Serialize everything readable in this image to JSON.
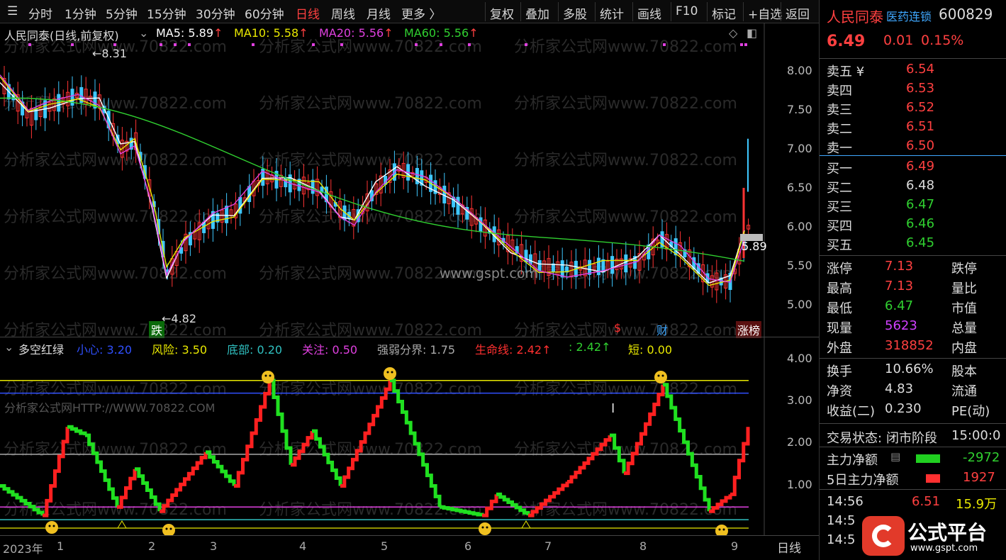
{
  "toolbar": {
    "periods": [
      "分时",
      "1分钟",
      "5分钟",
      "15分钟",
      "30分钟",
      "60分钟",
      "日线",
      "周线",
      "月线",
      "更多 〉"
    ],
    "active": "日线",
    "buttons": [
      "复权",
      "叠加",
      "多股",
      "统计",
      "画线",
      "F10",
      "标记",
      "+自选",
      "返回"
    ]
  },
  "main": {
    "title": "人民同泰(日线,前复权)",
    "ma5": "MA5: 5.89",
    "ma10": "MA10: 5.58",
    "ma20": "MA20: 5.56",
    "ma60": "MA60: 5.56",
    "arrow": "↑",
    "high_mark": "8.31",
    "low_mark": "4.82",
    "last_price_tag": "5.89",
    "watermark": "www.gspt.com",
    "tags": {
      "die": "跌",
      "s": "$",
      "cai": "财",
      "zhangbang": "涨榜"
    },
    "yaxis": [
      "8.00",
      "7.50",
      "7.00",
      "6.50",
      "6.00",
      "5.50",
      "5.00"
    ],
    "bg_watermark": "分析家公式网www.70822.com",
    "colors": {
      "up": "#ff3333",
      "down": "#3fc8ff",
      "ma5": "#ffffff",
      "ma10": "#e8e800",
      "ma20": "#e040e0",
      "ma60": "#30d030"
    }
  },
  "indicator": {
    "name": "多空红绿",
    "items": [
      {
        "k": "小心:",
        "v": "3.20",
        "c": "#3050ff"
      },
      {
        "k": "风险:",
        "v": "3.50",
        "c": "#e8e800"
      },
      {
        "k": "底部:",
        "v": "0.20",
        "c": "#30c0c0"
      },
      {
        "k": "关注:",
        "v": "0.50",
        "c": "#e040e0"
      },
      {
        "k": "强弱分界:",
        "v": "1.75",
        "c": "#aaaaaa"
      },
      {
        "k": "生命线:",
        "v": "2.42↑",
        "c": "#ff3030"
      },
      {
        "k": ":",
        "v": "2.42↑",
        "c": "#30d030"
      },
      {
        "k": "短:",
        "v": "0.00",
        "c": "#e8e800"
      }
    ],
    "yaxis": [
      "4.00",
      "3.00",
      "2.00",
      "1.00"
    ],
    "watermark2": "分析家公式网HTTP://WWW.70822.COM"
  },
  "xaxis": {
    "labels": [
      "2023年",
      "1",
      "2",
      "3",
      "4",
      "5",
      "6",
      "7",
      "8",
      "9"
    ],
    "period": "日线"
  },
  "quote": {
    "name": "人民同泰",
    "sector": "医药连锁",
    "code": "600829",
    "price": "6.49",
    "change": "0.01",
    "pct": "0.15%",
    "asks": [
      {
        "k": "卖五 ¥",
        "v": "6.54"
      },
      {
        "k": "卖四",
        "v": "6.53"
      },
      {
        "k": "卖三",
        "v": "6.52"
      },
      {
        "k": "卖二",
        "v": "6.51"
      },
      {
        "k": "卖一",
        "v": "6.50"
      }
    ],
    "bids": [
      {
        "k": "买一",
        "v": "6.49",
        "c": "#ff4040"
      },
      {
        "k": "买二",
        "v": "6.48",
        "c": "#dddddd"
      },
      {
        "k": "买三",
        "v": "6.47",
        "c": "#30d030"
      },
      {
        "k": "买四",
        "v": "6.46",
        "c": "#30d030"
      },
      {
        "k": "买五",
        "v": "6.45",
        "c": "#30d030"
      }
    ],
    "stats": [
      {
        "k": "涨停",
        "v": "7.13",
        "c": "#ff4040",
        "k2": "跌停"
      },
      {
        "k": "最高",
        "v": "7.13",
        "c": "#ff4040",
        "k2": "量比"
      },
      {
        "k": "最低",
        "v": "6.47",
        "c": "#30d030",
        "k2": "市值"
      },
      {
        "k": "现量",
        "v": "5623",
        "c": "#d040ff",
        "k2": "总量"
      },
      {
        "k": "外盘",
        "v": "318852",
        "c": "#ff4040",
        "k2": "内盘"
      }
    ],
    "fund": [
      {
        "k": "换手",
        "v": "10.66%",
        "k2": "股本"
      },
      {
        "k": "净资",
        "v": "4.83",
        "k2": "流通"
      },
      {
        "k": "收益(二)",
        "v": "0.230",
        "k2": "PE(动)"
      }
    ],
    "status_label": "交易状态:",
    "status": "闭市阶段",
    "status_time": "15:00:0",
    "main_net_label": "主力净额",
    "main_net": "-2972",
    "net5_label": "5日主力净额",
    "net5": "1927",
    "ticks": [
      {
        "t": "14:56",
        "p": "6.51",
        "v": "15.9万"
      },
      {
        "t": "14:5",
        "p": "",
        "v": ""
      },
      {
        "t": "14:5",
        "p": "",
        "v": ""
      }
    ],
    "logo_text": "公式平台",
    "logo_url": "www.gspt.com"
  }
}
